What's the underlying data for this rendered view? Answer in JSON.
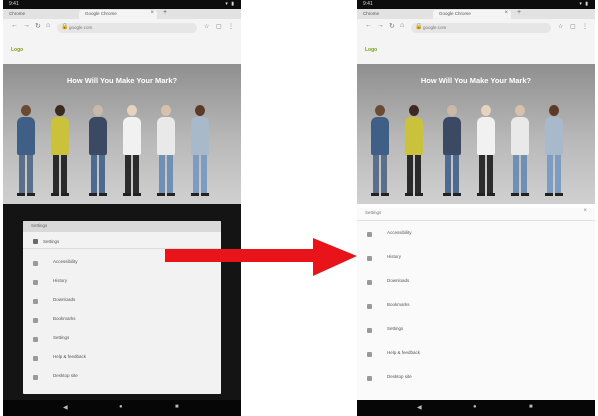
{
  "status": {
    "time": "9:41",
    "icons": "▾ ▮"
  },
  "browser": {
    "label": "Chrome",
    "tab_title": "Google Chrome",
    "url": "google.com",
    "brand": "Logo"
  },
  "hero": {
    "title": "How Will You Make Your Mark?",
    "people": [
      {
        "head": "#6b4a33",
        "body": "#3f5f86",
        "legs": "#5a6f8a"
      },
      {
        "head": "#3a2a20",
        "body": "#c9c23a",
        "legs": "#2a2a2a"
      },
      {
        "head": "#c9b9a8",
        "body": "#3b4a62",
        "legs": "#4d6a91"
      },
      {
        "head": "#e6d2bd",
        "body": "#f1f1f1",
        "legs": "#2c2c2c"
      },
      {
        "head": "#d8c1aa",
        "body": "#e9e9e9",
        "legs": "#6f8fb3"
      },
      {
        "head": "#5b3a28",
        "body": "#a9b9cc",
        "legs": "#7e9bc0"
      }
    ]
  },
  "left_dialog": {
    "header": "Settings",
    "section": "Settings",
    "rows": [
      {
        "title": "Accessibility",
        "sub": ""
      },
      {
        "title": "History",
        "sub": ""
      },
      {
        "title": "Downloads",
        "sub": ""
      },
      {
        "title": "Bookmarks",
        "sub": ""
      },
      {
        "title": "Settings",
        "sub": ""
      },
      {
        "title": "Help & feedback",
        "sub": ""
      },
      {
        "title": "Desktop site",
        "sub": ""
      }
    ]
  },
  "right_sheet": {
    "title": "Settings",
    "rows": [
      {
        "title": "Accessibility",
        "sub": ""
      },
      {
        "title": "History",
        "sub": ""
      },
      {
        "title": "Downloads",
        "sub": ""
      },
      {
        "title": "Bookmarks",
        "sub": ""
      },
      {
        "title": "Settings",
        "sub": ""
      },
      {
        "title": "Help & feedback",
        "sub": ""
      },
      {
        "title": "Desktop site",
        "sub": ""
      }
    ]
  },
  "nav": {
    "back": "◀",
    "home": "●",
    "recents": "■"
  },
  "colors": {
    "arrow": "#e8141a",
    "brand": "#7a9e19"
  }
}
